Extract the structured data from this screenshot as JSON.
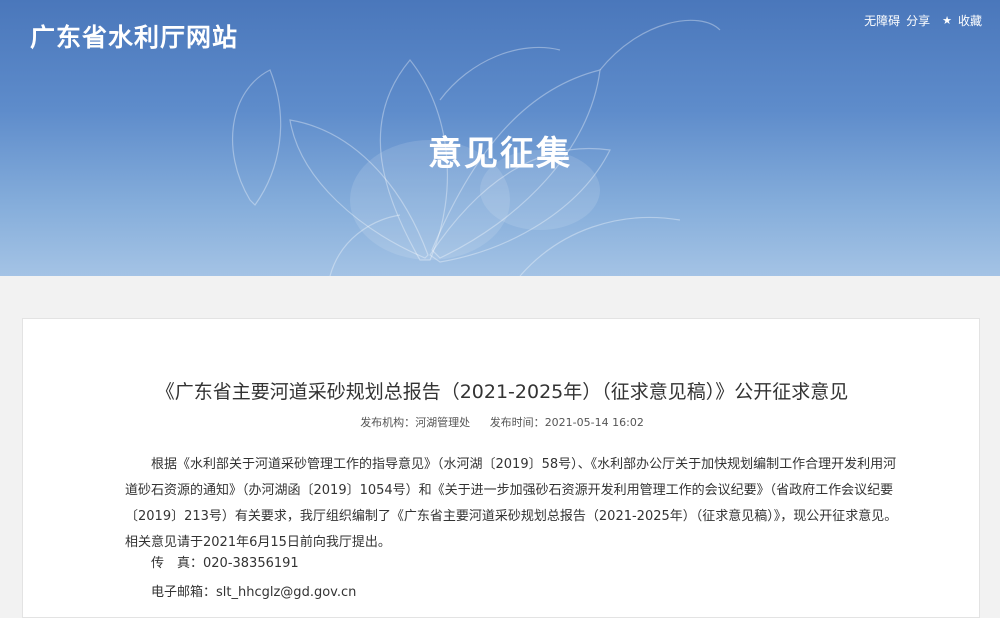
{
  "site": {
    "name": "广东省水利厅网站"
  },
  "toolbar": {
    "accessibility": "无障碍",
    "share": "分享",
    "favorite_icon": "★",
    "favorite": "收藏"
  },
  "section": {
    "title": "意见征集"
  },
  "article": {
    "title": "《广东省主要河道采砂规划总报告（2021-2025年）（征求意见稿）》公开征求意见",
    "publisher_label": "发布机构：",
    "publisher": "河湖管理处",
    "date_label": "发布时间：",
    "date": "2021-05-14 16:02",
    "body": "根据《水利部关于河道采砂管理工作的指导意见》（水河湖〔2019〕58号）、《水利部办公厅关于加快规划编制工作合理开发利用河道砂石资源的通知》（办河湖函〔2019〕1054号）和《关于进一步加强砂石资源开发利用管理工作的会议纪要》（省政府工作会议纪要〔2019〕213号）有关要求，我厅组织编制了《广东省主要河道采砂规划总报告（2021-2025年）（征求意见稿）》，现公开征求意见。相关意见请于2021年6月15日前向我厅提出。",
    "fax_label": "传　真：",
    "fax": "020-38356191",
    "email_label": "电子邮箱：",
    "email": "slt_hhcglz@gd.gov.cn"
  },
  "colors": {
    "banner_top": "#4a77bb",
    "banner_bottom": "#a4c3e5",
    "page_bg": "#f2f2f2"
  }
}
